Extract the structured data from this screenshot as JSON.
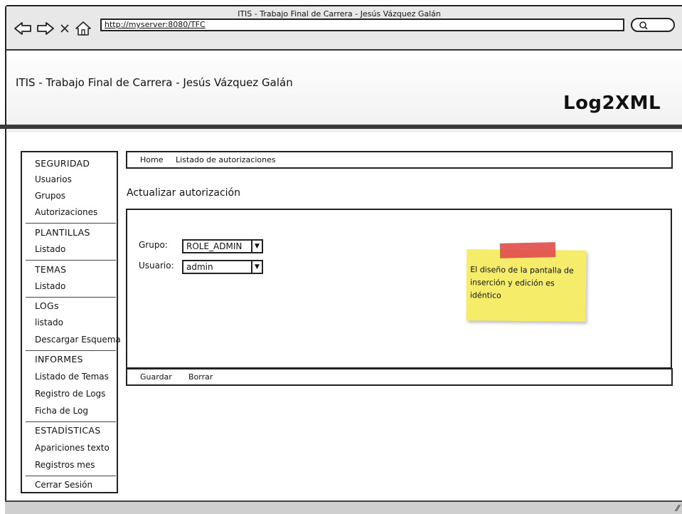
{
  "browser": {
    "window_title": "ITIS - Trabajo Final de Carrera -  Jesús Vázquez Galán",
    "url": "http://myserver:8080/TFC",
    "nav_icons": [
      "back-arrow-icon",
      "forward-arrow-icon",
      "close-x-icon",
      "home-icon"
    ],
    "search_icon": "search-icon"
  },
  "header": {
    "site_title": "ITIS - Trabajo Final de Carrera - Jesús Vázquez Galán",
    "brand": "Log2XML"
  },
  "sidebar": {
    "sections": [
      {
        "heading": "SEGURIDAD",
        "items": [
          "Usuarios",
          "Grupos",
          "Autorizaciones"
        ]
      },
      {
        "heading": "PLANTILLAS",
        "items": [
          "Listado"
        ]
      },
      {
        "heading": "TEMAS",
        "items": [
          "Listado"
        ]
      },
      {
        "heading": "LOGs",
        "items": [
          "listado",
          "Descargar Esquema"
        ]
      },
      {
        "heading": "INFORMES",
        "items": [
          "Listado de Temas",
          "Registro de Logs",
          "Ficha de Log"
        ]
      },
      {
        "heading": "ESTADÍSTICAS",
        "items": [
          "Apariciones texto",
          "Registros mes"
        ]
      }
    ],
    "logout": "Cerrar Sesión"
  },
  "breadcrumb": {
    "home": "Home",
    "current": "Listado de autorizaciones"
  },
  "page": {
    "title": "Actualizar autorización"
  },
  "form": {
    "grupo_label": "Grupo:",
    "grupo_value": "ROLE_ADMIN",
    "usuario_label": "Usuario:",
    "usuario_value": "admin"
  },
  "note": {
    "text": "El diseño de la pantalla de inserción y edición es idéntico",
    "color": "#f5ec6a",
    "tape_color": "#e04b4b"
  },
  "actions": {
    "save": "Guardar",
    "delete": "Borrar"
  }
}
